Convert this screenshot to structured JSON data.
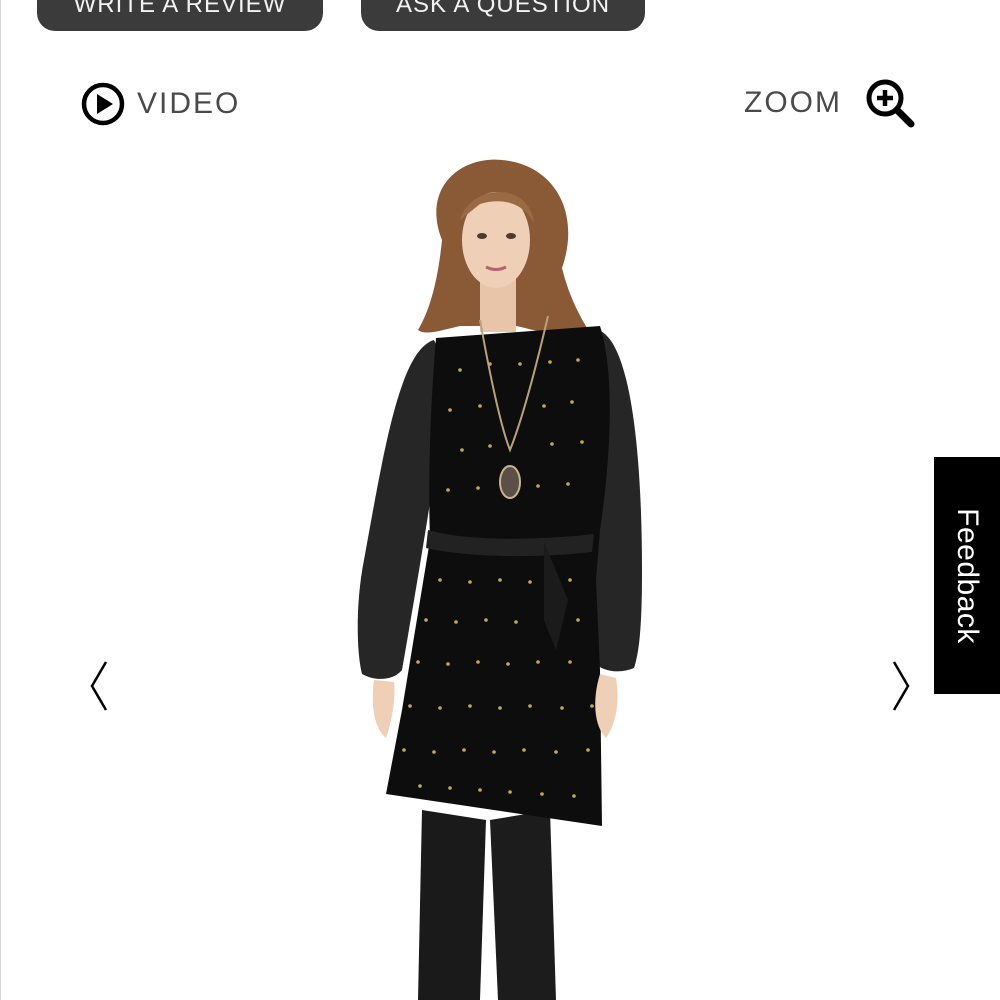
{
  "actions": {
    "write_review_label": "WRITE A REVIEW",
    "ask_question_label": "ASK A QUESTION"
  },
  "media": {
    "video_label": "VIDEO",
    "video_icon": "play-circle-icon",
    "zoom_label": "ZOOM",
    "zoom_icon": "zoom-in-icon"
  },
  "carousel": {
    "prev_icon": "chevron-left-icon",
    "next_icon": "chevron-right-icon"
  },
  "feedback": {
    "label": "Feedback"
  },
  "colors": {
    "pill_bg": "#3b3b3b",
    "text_gray": "#4a4a4a",
    "feedback_bg": "#000000"
  }
}
